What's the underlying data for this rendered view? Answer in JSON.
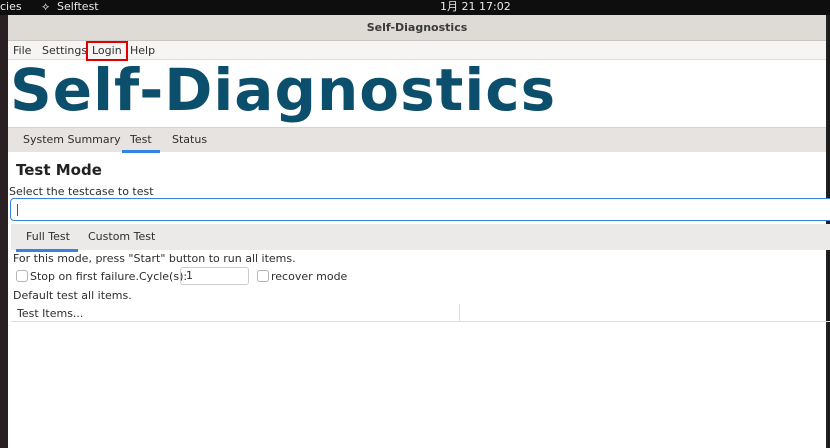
{
  "topbar": {
    "activities": "cies",
    "app": "Selftest",
    "clock": "1月 21  17:02"
  },
  "window": {
    "title": "Self-Diagnostics"
  },
  "menu": [
    "File",
    "Settings",
    "Login",
    "Help"
  ],
  "banner": "Self-Diagnostics",
  "tabs": [
    "System Summary",
    "Test",
    "Status"
  ],
  "test": {
    "heading": "Test Mode",
    "select_label": "Select the testcase to test",
    "select_value": "",
    "subtabs": [
      "Full Test",
      "Custom Test"
    ],
    "info": "For this mode, press \"Start\" button to run all items.",
    "stop_label": "Stop on first failure.",
    "cycles_label": "Cycle(s):",
    "cycles_value": "1",
    "recover_label": "recover mode",
    "default_text": "Default test all items.",
    "table_header": "Test Items..."
  }
}
